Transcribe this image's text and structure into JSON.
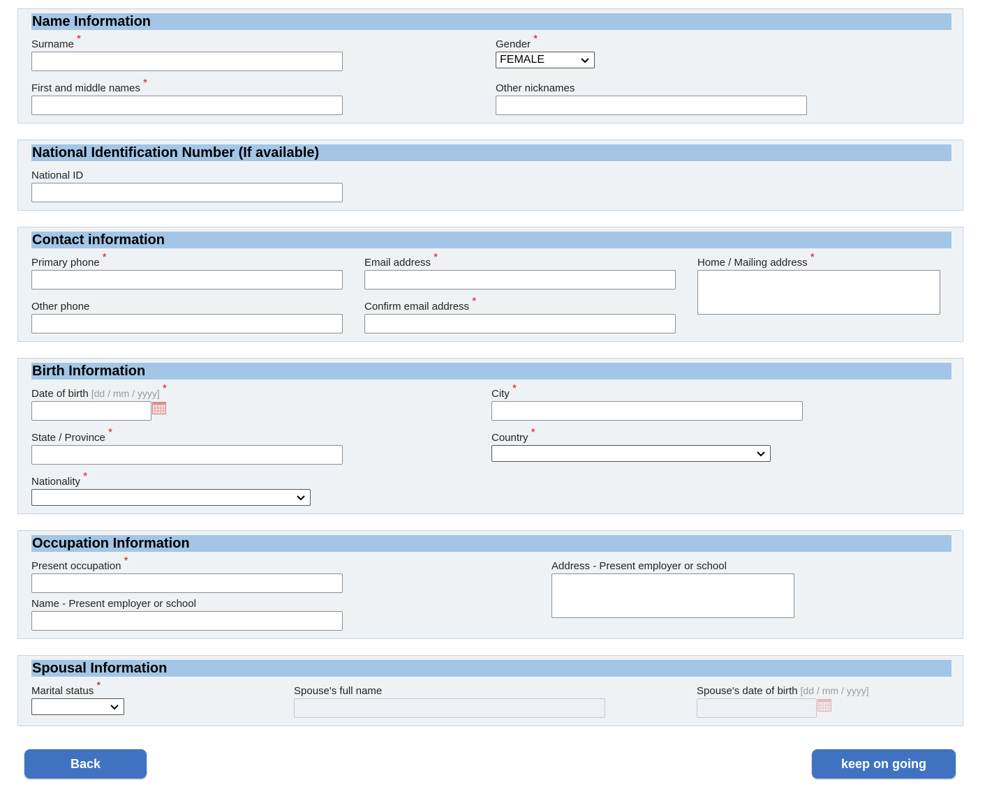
{
  "name_section": {
    "title": "Name Information",
    "surname_label": "Surname",
    "gender_label": "Gender",
    "gender_value": "FEMALE",
    "first_middle_label": "First and middle names",
    "nicknames_label": "Other nicknames"
  },
  "national_id_section": {
    "title": "National Identification Number (If available)",
    "national_id_label": "National ID"
  },
  "contact_section": {
    "title": "Contact information",
    "primary_phone_label": "Primary phone",
    "email_label": "Email address",
    "home_address_label": "Home / Mailing address",
    "other_phone_label": "Other phone",
    "confirm_email_label": "Confirm email address"
  },
  "birth_section": {
    "title": "Birth Information",
    "dob_label": "Date of birth",
    "date_hint": "[dd / mm / yyyy]",
    "city_label": "City",
    "state_label": "State / Province",
    "country_label": "Country",
    "nationality_label": "Nationality"
  },
  "occupation_section": {
    "title": "Occupation Information",
    "present_occupation_label": "Present occupation",
    "employer_address_label": "Address - Present employer or school",
    "employer_name_label": "Name - Present employer or school"
  },
  "spousal_section": {
    "title": "Spousal Information",
    "marital_status_label": "Marital status",
    "spouse_name_label": "Spouse's full name",
    "spouse_dob_label": "Spouse's date of birth",
    "date_hint": "[dd / mm / yyyy]"
  },
  "required_marker": "*",
  "buttons": {
    "back": "Back",
    "next": "keep on going"
  },
  "colors": {
    "section_header": "#a3c6e6",
    "section_bg": "#eff2f5",
    "required": "#cc1f1f",
    "button": "#3f73c1"
  }
}
